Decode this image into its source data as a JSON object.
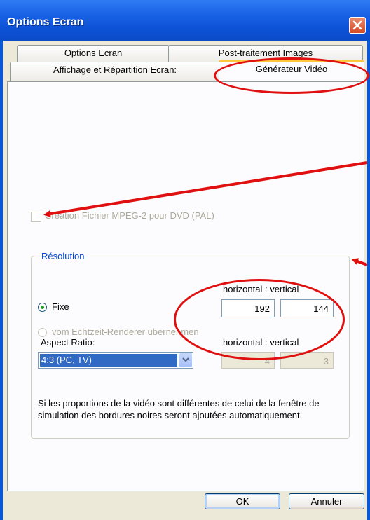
{
  "window": {
    "title": "Options Ecran",
    "close_icon": "close-icon",
    "accent": "#0a57d8"
  },
  "tabs": {
    "row1": [
      {
        "label": "Options Ecran"
      },
      {
        "label": "Post-traitement Images"
      }
    ],
    "row2": [
      {
        "label": "Affichage et Répartition Ecran:"
      },
      {
        "label": "Générateur Vidéo",
        "active": true
      }
    ]
  },
  "panel": {
    "mpeg_checkbox": {
      "label": "Création Fichier MPEG-2 pour DVD (PAL)",
      "checked": false,
      "enabled": false
    },
    "resolution": {
      "legend": "Résolution",
      "header_1": "horizontal : vertical",
      "fixed_label": "Fixe",
      "fixed_selected": true,
      "horizontal": "192",
      "vertical": "144",
      "renderer_label": "vom Echtzeit-Renderer übernehmen",
      "aspect_label": "Aspect Ratio:",
      "header_2": "horizontal : vertical",
      "aspect_value": "4:3 (PC, TV)",
      "aspect_h": "4",
      "aspect_v": "3",
      "note": "Si les proportions de la vidéo sont différentes de celui de la fenêtre de simulation des bordures noires seront ajoutées automatiquement."
    }
  },
  "buttons": {
    "ok": "OK",
    "cancel": "Annuler"
  },
  "annotation_color": "#e01010"
}
